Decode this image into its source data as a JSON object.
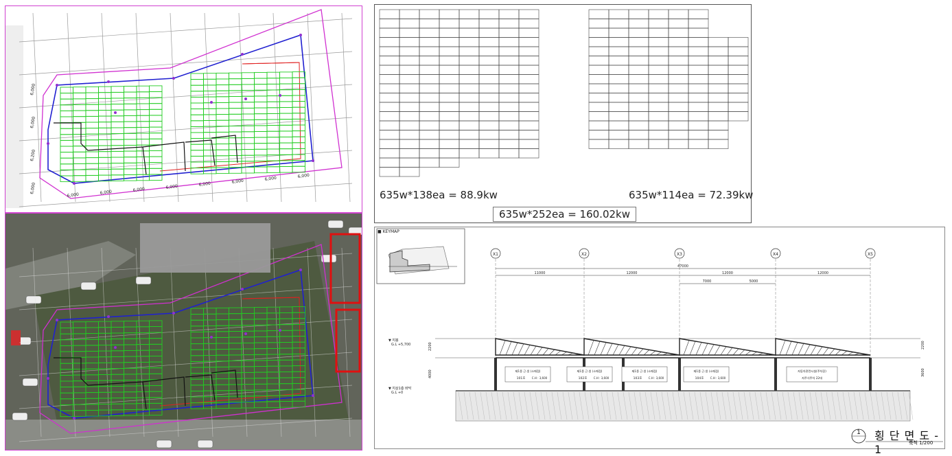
{
  "plan": {
    "dims": [
      "6,000",
      "6,000",
      "6,000",
      "6,000",
      "6,000",
      "6,000",
      "6,000",
      "6,000"
    ],
    "side_dims": [
      "6,000",
      "6,000",
      "6,200",
      "6,000"
    ]
  },
  "layout": {
    "left_caption": "635w*138ea = 88.9kw",
    "right_caption": "635w*114ea = 72.39kw",
    "total_caption": "635w*252ea = 160.02kw"
  },
  "section": {
    "keymap_label": "■ KEYMAP",
    "axes": [
      "X1",
      "X2",
      "X3",
      "X4",
      "X5"
    ],
    "total_dim": "47000",
    "spans": [
      "11000",
      "12000",
      "12000",
      "12000"
    ],
    "sub_spans": [
      "7000",
      "5000"
    ],
    "level_roof": "▼ 지붕",
    "level_roof_gl": "G.L +5,700",
    "level_ground": "▼ 지상1층 바닥",
    "level_ground_gl": "G.L +0",
    "left_dims": [
      "2200",
      "4000"
    ],
    "right_dims": [
      "2200",
      "3600"
    ],
    "units": [
      {
        "name": "제1종 근.생 (소매점)",
        "room": "101호",
        "ch": "C.H : 3,600"
      },
      {
        "name": "제1종 근.생 (소매점)",
        "room": "102호",
        "ch": "C.H : 3,600"
      },
      {
        "name": "제1종 근.생 (소매점)",
        "room": "103호",
        "ch": "C.H : 3,600"
      },
      {
        "name": "제1종 근.생 (소매점)",
        "room": "104호",
        "ch": "C.H : 3,600"
      }
    ],
    "parking_name": "자동차관련시설(주차장)",
    "parking_desc": "자주식주차 22대",
    "drawing_no": "1",
    "title": "횡 단 면 도 - 1",
    "scale": "축척 1/200"
  }
}
